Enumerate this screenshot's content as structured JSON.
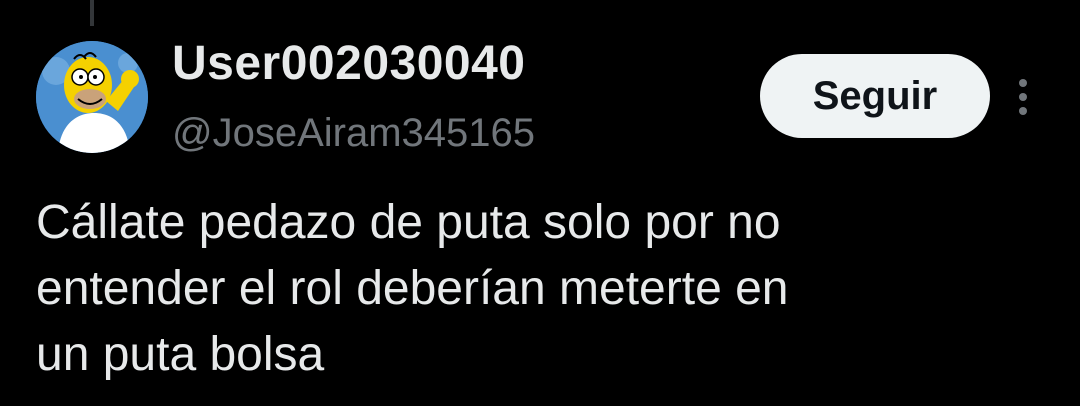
{
  "user": {
    "display_name": "User002030040",
    "handle": "@JoseAiram345165"
  },
  "actions": {
    "follow_label": "Seguir",
    "more_icon": "more-vertical-icon"
  },
  "tweet": {
    "lines": [
      "Cállate pedazo de puta solo por no",
      "entender el rol deberían meterte en",
      "un puta bolsa"
    ]
  },
  "colors": {
    "background": "#000000",
    "primary_text": "#e7e9ea",
    "secondary_text": "#71767b",
    "button_bg": "#eff3f4",
    "button_text": "#0f1419"
  }
}
